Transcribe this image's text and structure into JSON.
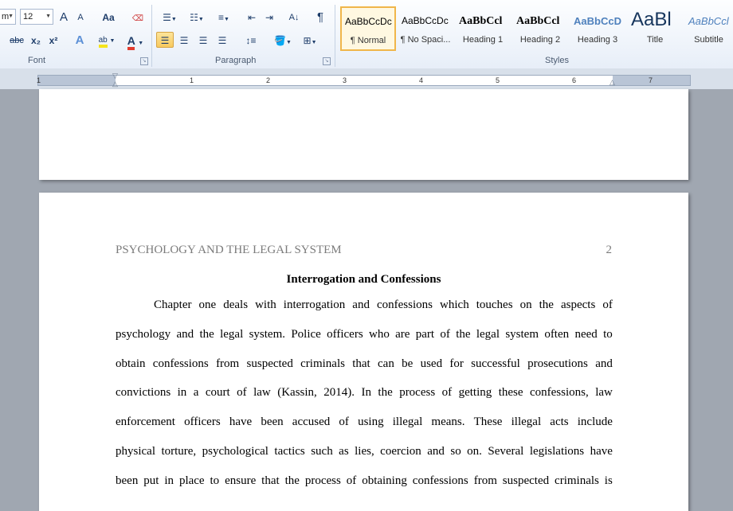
{
  "ribbon": {
    "font": {
      "label": "Font",
      "font_name_value": "m",
      "font_size_value": "12",
      "grow_label": "A",
      "shrink_label": "A",
      "change_case_label": "Aa",
      "strike_label": "abc",
      "subscript_label": "x₂",
      "superscript_label": "x²",
      "text_effects_label": "A",
      "highlight_label": "ab",
      "font_color_label": "A",
      "highlight_color": "#f6e41b",
      "font_color": "#e23b2e"
    },
    "paragraph": {
      "label": "Paragraph",
      "show_marks_label": "¶",
      "sort_label": "A↓"
    },
    "styles": {
      "label": "Styles",
      "items": [
        {
          "preview": "AaBbCcDc",
          "name": "¶ Normal",
          "selected": true
        },
        {
          "preview": "AaBbCcDc",
          "name": "¶ No Spaci...",
          "selected": false
        },
        {
          "preview": "AaBbCcl",
          "name": "Heading 1",
          "selected": false
        },
        {
          "preview": "AaBbCcl",
          "name": "Heading 2",
          "selected": false
        },
        {
          "preview": "AaBbCcD",
          "name": "Heading 3",
          "selected": false
        },
        {
          "preview": "AaBl",
          "name": "Title",
          "selected": false
        },
        {
          "preview": "AaBbCcl",
          "name": "Subtitle",
          "selected": false
        }
      ]
    }
  },
  "ruler": {
    "numbers": [
      "1",
      "1",
      "2",
      "3",
      "4",
      "5",
      "6",
      "7"
    ]
  },
  "document": {
    "header": "PSYCHOLOGY AND THE LEGAL SYSTEM",
    "page_number": "2",
    "title": "Interrogation and Confessions",
    "lines": [
      "Chapter one deals with interrogation and confessions which touches on the aspects of",
      "psychology and the legal system. Police officers who are part of the legal system often need to",
      "obtain confessions from suspected criminals that can be used for successful prosecutions and",
      "convictions in a court of law (Kassin, 2014). In the process of getting these confessions, law",
      "enforcement officers have been accused of using illegal means. These illegal acts include",
      "physical torture, psychological tactics such as lies, coercion and so on. Several legislations have",
      "been put in place to ensure that the process of obtaining confessions from suspected criminals is"
    ]
  }
}
